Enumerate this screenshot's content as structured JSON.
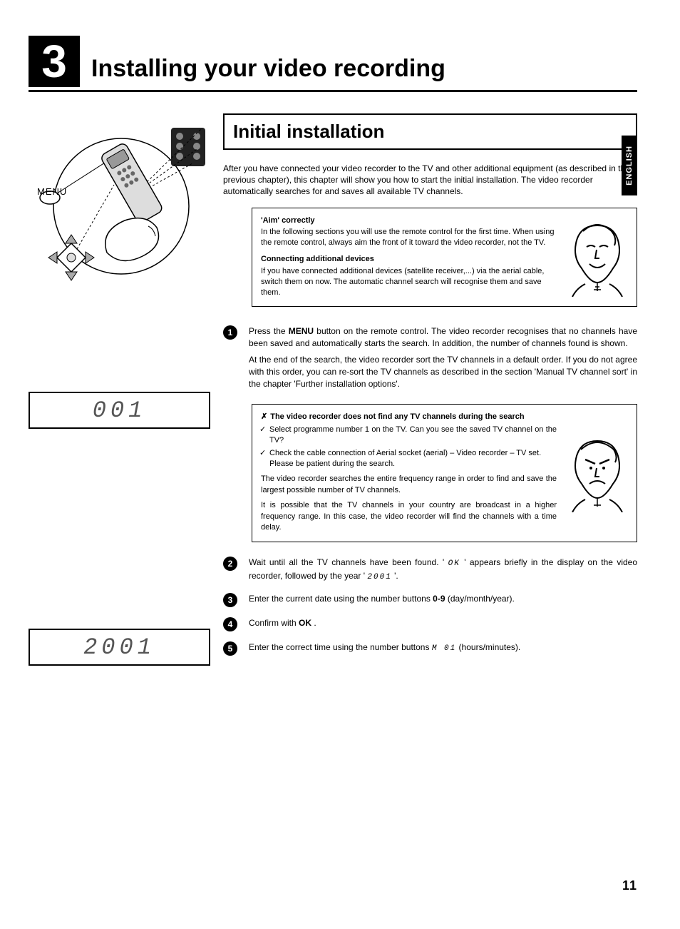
{
  "chapter": {
    "number": "3",
    "title": "Installing your video recording"
  },
  "language_tab": "ENGLISH",
  "section_title": "Initial installation",
  "intro": "After you have connected your video recorder to the TV and other additional equipment (as described in the previous chapter), this chapter will show you how to start the initial installation. The video recorder automatically searches for and saves all available TV channels.",
  "tip_box1": {
    "heading1": "'Aim' correctly",
    "text1": "In the following sections you will use the remote control for the first time. When using the remote control, always aim the front of it toward the video recorder, not the TV.",
    "heading2": "Connecting additional devices",
    "text2": "If you have connected additional devices (satellite receiver,...) via the aerial cable, switch them on now. The automatic channel search will recognise them and save them."
  },
  "steps": {
    "s1_a": "Press the ",
    "s1_b": "MENU",
    "s1_c": " button on the remote control. The video recorder recognises that no channels have been saved and automatically starts the search. In addition, the number of channels found is shown.",
    "s1_d": "At the end of the search, the video recorder sort the TV channels in a default order. If you do not agree with this order, you can re-sort the TV channels as described in the section 'Manual TV channel sort' in the chapter 'Further installation options'.",
    "s2_a": "Wait until all the TV channels have been found. ' ",
    "s2_b": "OK",
    "s2_c": " ' appears briefly in the display on the video recorder, followed by the year ' ",
    "s2_d": "2001",
    "s2_e": " '.",
    "s3_a": "Enter the current date using the number buttons ",
    "s3_b": "0-9",
    "s3_c": " (day/month/year).",
    "s4_a": "Confirm with ",
    "s4_b": "OK",
    "s4_c": " .",
    "s5_a": "Enter the correct time using the number buttons ",
    "s5_b": "M 01",
    "s5_c": " (hours/minutes)."
  },
  "trouble_box": {
    "heading": "The video recorder does not find any TV channels during the search",
    "item1": "Select programme number 1 on the TV. Can you see the saved TV channel on the TV?",
    "item2": "Check the cable connection of Aerial socket (aerial) – Video recorder – TV set.",
    "item2b": "Please be patient during the search.",
    "note": "The video recorder searches the entire frequency range in order to find and save the largest possible number of TV channels.",
    "note2": "It is possible that the TV channels in your country are broadcast in a higher frequency range. In this case, the video recorder will find the channels with a time delay."
  },
  "lcd": {
    "d1": "001",
    "d2": "2001"
  },
  "menu_label": "MENU",
  "page_number": "11"
}
